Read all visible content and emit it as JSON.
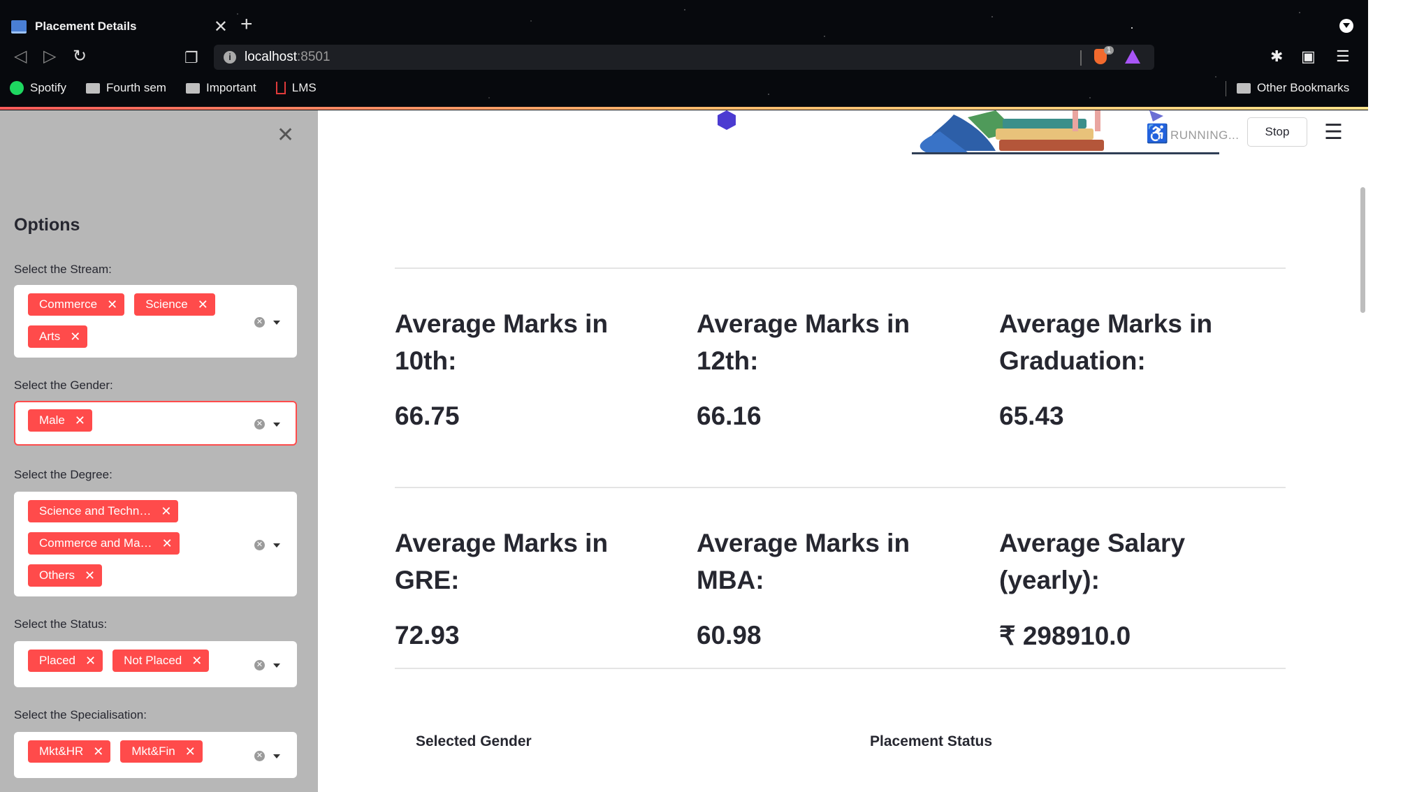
{
  "browser": {
    "tab_title": "Placement Details",
    "url_host": "localhost",
    "url_port": ":8501",
    "shield_count": "1",
    "bookmarks": [
      "Spotify",
      "Fourth sem",
      "Important",
      "LMS"
    ],
    "other_bookmarks": "Other Bookmarks"
  },
  "sidebar": {
    "heading": "Options",
    "filters": [
      {
        "label": "Select the Stream:",
        "tags": [
          "Commerce",
          "Science",
          "Arts"
        ]
      },
      {
        "label": "Select the Gender:",
        "tags": [
          "Male"
        ]
      },
      {
        "label": "Select the Degree:",
        "tags": [
          "Science and Techn…",
          "Commerce and Ma…",
          "Others"
        ]
      },
      {
        "label": "Select the Status:",
        "tags": [
          "Placed",
          "Not Placed"
        ]
      },
      {
        "label": "Select the Specialisation:",
        "tags": [
          "Mkt&HR",
          "Mkt&Fin"
        ]
      }
    ]
  },
  "status": {
    "running": "RUNNING...",
    "stop": "Stop"
  },
  "metrics": [
    {
      "label": "Average Marks in 10th:",
      "value": "66.75"
    },
    {
      "label": "Average Marks in 12th:",
      "value": "66.16"
    },
    {
      "label": "Average Marks in Graduation:",
      "value": "65.43"
    },
    {
      "label": "Average Marks in GRE:",
      "value": "72.93"
    },
    {
      "label": "Average Marks in MBA:",
      "value": "60.98"
    },
    {
      "label": "Average Salary (yearly):",
      "value": "₹ 298910.0"
    }
  ],
  "sections": {
    "left": "Selected Gender",
    "right": "Placement Status"
  },
  "colors": {
    "accent": "#ff4b4b",
    "sidebar_bg": "#b7b7b7",
    "text": "#262730"
  }
}
